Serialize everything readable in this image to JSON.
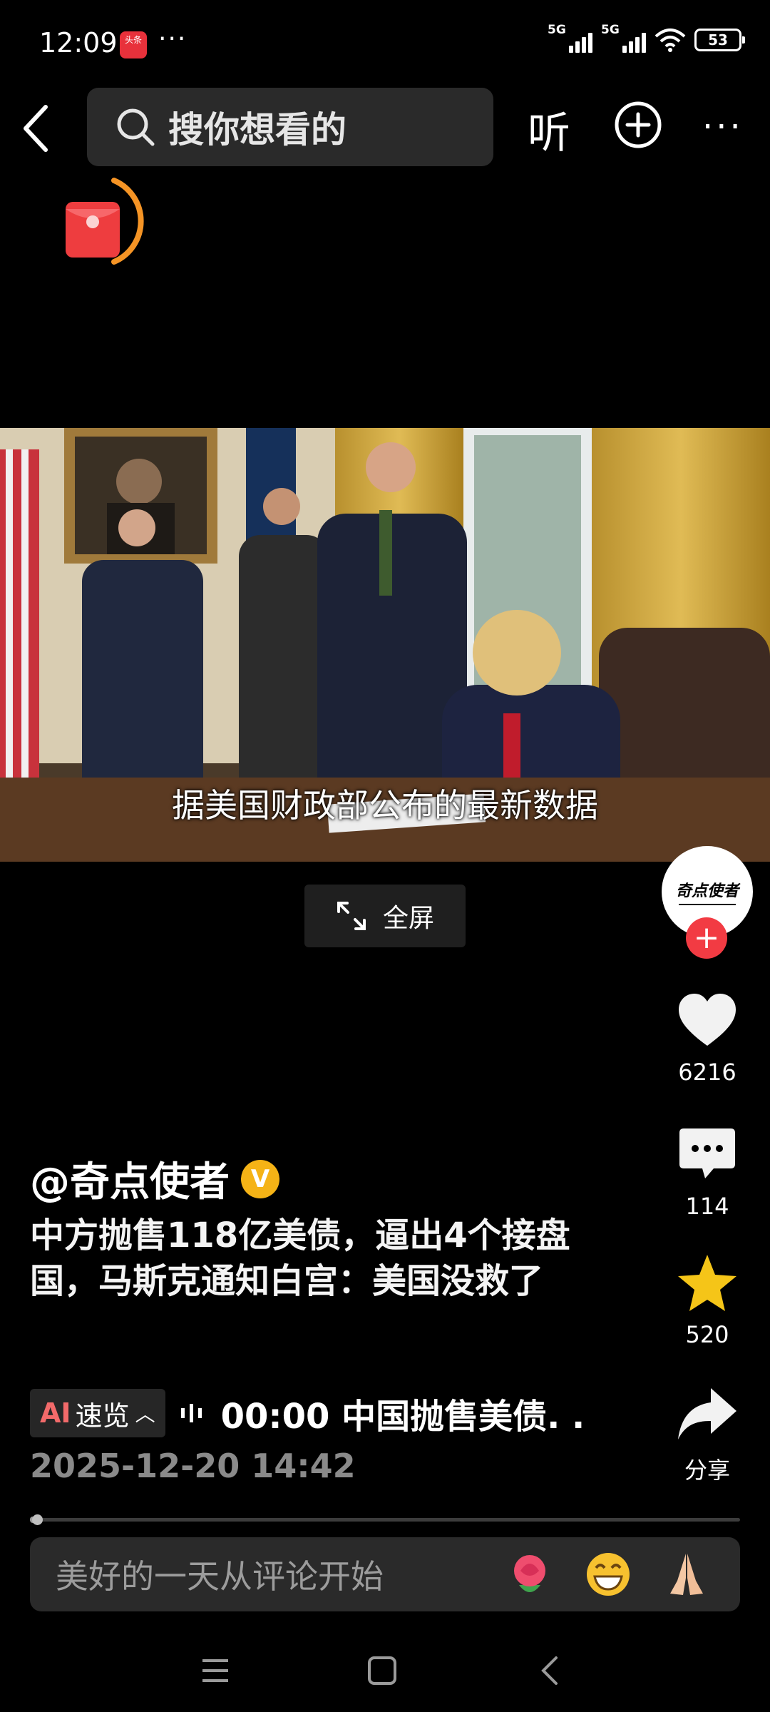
{
  "status_bar": {
    "time": "12:09",
    "app_badge": "头条",
    "more": "···",
    "sim1": "5G",
    "sim2": "5G",
    "battery": "53"
  },
  "nav": {
    "search_placeholder": "搜你想看的",
    "listen_label": "听",
    "more_label": "···"
  },
  "video": {
    "subtitle": "据美国财政部公布的最新数据",
    "fullscreen_label": "全屏"
  },
  "author": {
    "avatar_text": "奇点使者",
    "handle": "@奇点使者",
    "verified_label": "V"
  },
  "rail": {
    "likes": "6216",
    "comments": "114",
    "favorites": "520",
    "share_label": "分享"
  },
  "post": {
    "title": "中方抛售118亿美债，逼出4个接盘国，马斯克通知白宫：美国没救了",
    "ai_label_prefix": "AI",
    "ai_label": "速览",
    "chapter": "00:00 中国抛售美债. .",
    "date": "2025-12-20 14:42",
    "progress": 0.01
  },
  "comment": {
    "placeholder": "美好的一天从评论开始"
  },
  "colors": {
    "accent_red": "#f23b43",
    "favorite_yellow": "#f5c518",
    "verified": "#f5b316"
  }
}
